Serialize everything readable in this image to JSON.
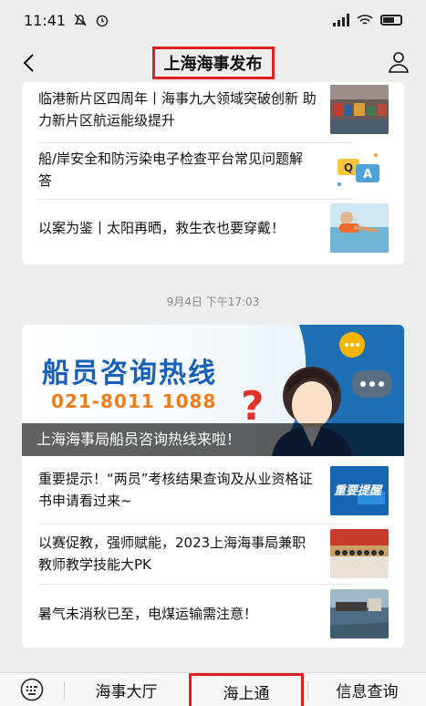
{
  "status_bar": {
    "time": "11:41"
  },
  "nav": {
    "title": "上海海事发布"
  },
  "card1": {
    "items": [
      {
        "text": "临港新片区四周年丨海事九大领域突破创新 助力新片区航运能级提升"
      },
      {
        "text": "船/岸安全和防污染电子检查平台常见问题解答"
      },
      {
        "text": "以案为鉴丨太阳再晒，救生衣也要穿戴！"
      }
    ]
  },
  "date_separator": "9月4日 下午17:03",
  "card2": {
    "banner": {
      "headline": "船员咨询热线",
      "phone": "021-8011 1088",
      "caption": "上海海事局船员咨询热线来啦！"
    },
    "items": [
      {
        "text": "重要提示！“两员”考核结果查询及从业资格证书申请看过来~",
        "thumb_text": "重要提醒"
      },
      {
        "text": "以赛促教，强师赋能，2023上海海事局兼职教师教学技能大PK"
      },
      {
        "text": "暑气未消秋已至，电煤运输需注意！"
      }
    ]
  },
  "bottom_menu": {
    "tabs": [
      {
        "label": "海事大厅"
      },
      {
        "label": "海上通"
      },
      {
        "label": "信息查询"
      }
    ]
  },
  "colors": {
    "highlight": "#e02020",
    "banner_blue": "#1860b8",
    "banner_orange": "#f07d1a"
  }
}
